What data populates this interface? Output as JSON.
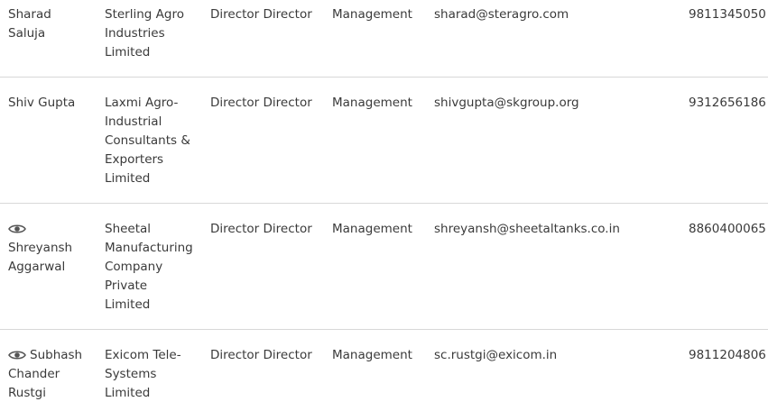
{
  "rows": [
    {
      "name_lines": [
        "Sharad",
        "Saluja"
      ],
      "has_eye_icon": false,
      "company_lines": [
        "Sterling Agro",
        "Industries",
        "Limited"
      ],
      "designation": "Director Director",
      "department": "Management",
      "email": "sharad@steragro.com",
      "phone": "9811345050"
    },
    {
      "name_lines": [
        "Shiv Gupta"
      ],
      "has_eye_icon": false,
      "company_lines": [
        "Laxmi Agro-",
        "Industrial",
        "Consultants &",
        "Exporters",
        "Limited"
      ],
      "designation": "Director Director",
      "department": "Management",
      "email": "shivgupta@skgroup.org",
      "phone": "9312656186"
    },
    {
      "name_lines": [
        "Shreyansh",
        "Aggarwal"
      ],
      "has_eye_icon": true,
      "company_lines": [
        "Sheetal",
        "Manufacturing",
        "Company",
        "Private",
        "Limited"
      ],
      "designation": "Director Director",
      "department": "Management",
      "email": "shreyansh@sheetaltanks.co.in",
      "phone": "8860400065"
    },
    {
      "name_lines": [
        "Subhash",
        "Chander",
        "Rustgi"
      ],
      "has_eye_icon": true,
      "company_lines": [
        "Exicom Tele-",
        "Systems",
        "Limited"
      ],
      "designation": "Director Director",
      "department": "Management",
      "email": "sc.rustgi@exicom.in",
      "phone": "9811204806"
    }
  ],
  "icons": {
    "eye": "eye-icon"
  },
  "colors": {
    "text": "#3a3a3a",
    "divider": "#d8d8d8",
    "background": "#ffffff"
  }
}
